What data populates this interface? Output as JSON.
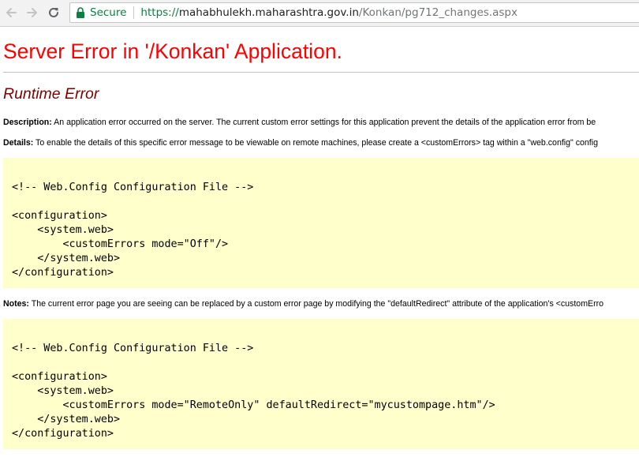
{
  "browser": {
    "secure_label": "Secure",
    "url_scheme": "https://",
    "url_host": "mahabhulekh.maharashtra.gov.in",
    "url_path": "/Konkan/pg712_changes.aspx"
  },
  "page": {
    "title": "Server Error in '/Konkan' Application.",
    "subtitle": "Runtime Error",
    "description_label": "Description:",
    "description_text": " An application error occurred on the server. The current custom error settings for this application prevent the details of the application error from be",
    "details_label": "Details:",
    "details_text": " To enable the details of this specific error message to be viewable on remote machines, please create a <customErrors> tag within a \"web.config\" config",
    "code_block_1": "<!-- Web.Config Configuration File -->\n\n<configuration>\n    <system.web>\n        <customErrors mode=\"Off\"/>\n    </system.web>\n</configuration>",
    "notes_label": "Notes:",
    "notes_text": " The current error page you are seeing can be replaced by a custom error page by modifying the \"defaultRedirect\" attribute of the application's <customErro",
    "code_block_2": "<!-- Web.Config Configuration File -->\n\n<configuration>\n    <system.web>\n        <customErrors mode=\"RemoteOnly\" defaultRedirect=\"mycustompage.htm\"/>\n    </system.web>\n</configuration>"
  },
  "colors": {
    "title": "#ff0000",
    "subtitle": "#800000",
    "code_background": "#ffffcc",
    "secure": "#0b8043"
  },
  "icons": {
    "back": "back-arrow-icon",
    "forward": "forward-arrow-icon",
    "reload": "reload-icon",
    "lock": "lock-icon"
  }
}
